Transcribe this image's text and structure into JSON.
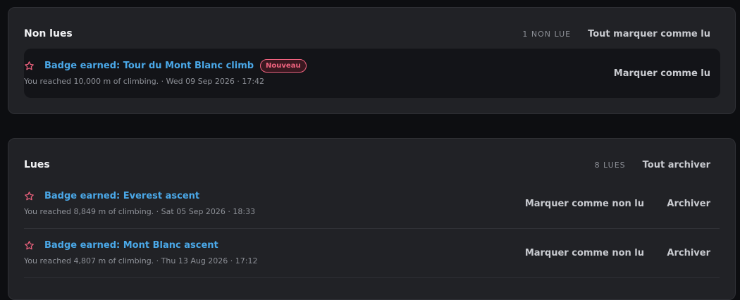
{
  "unread_section": {
    "title": "Non lues",
    "count_label": "1 NON LUE",
    "mark_all_label": "Tout marquer comme lu",
    "items": [
      {
        "title": "Badge earned: Tour du Mont Blanc climb",
        "badge": "Nouveau",
        "meta": "You reached 10,000 m of climbing. · Wed 09 Sep 2026 · 17:42",
        "action_label": "Marquer comme lu"
      }
    ]
  },
  "read_section": {
    "title": "Lues",
    "count_label": "8 LUES",
    "archive_all_label": "Tout archiver",
    "items": [
      {
        "title": "Badge earned: Everest ascent",
        "meta": "You reached 8,849 m of climbing. · Sat 05 Sep 2026 · 18:33",
        "mark_unread_label": "Marquer comme non lu",
        "archive_label": "Archiver"
      },
      {
        "title": "Badge earned: Mont Blanc ascent",
        "meta": "You reached 4,807 m of climbing. · Thu 13 Aug 2026 · 17:12",
        "mark_unread_label": "Marquer comme non lu",
        "archive_label": "Archiver"
      }
    ]
  },
  "icons": {
    "item_icon": "star-outline-icon",
    "icon_color": "#f0637f"
  },
  "colors": {
    "accent_link": "#4aa8e8",
    "badge_new": "#f0637f"
  }
}
